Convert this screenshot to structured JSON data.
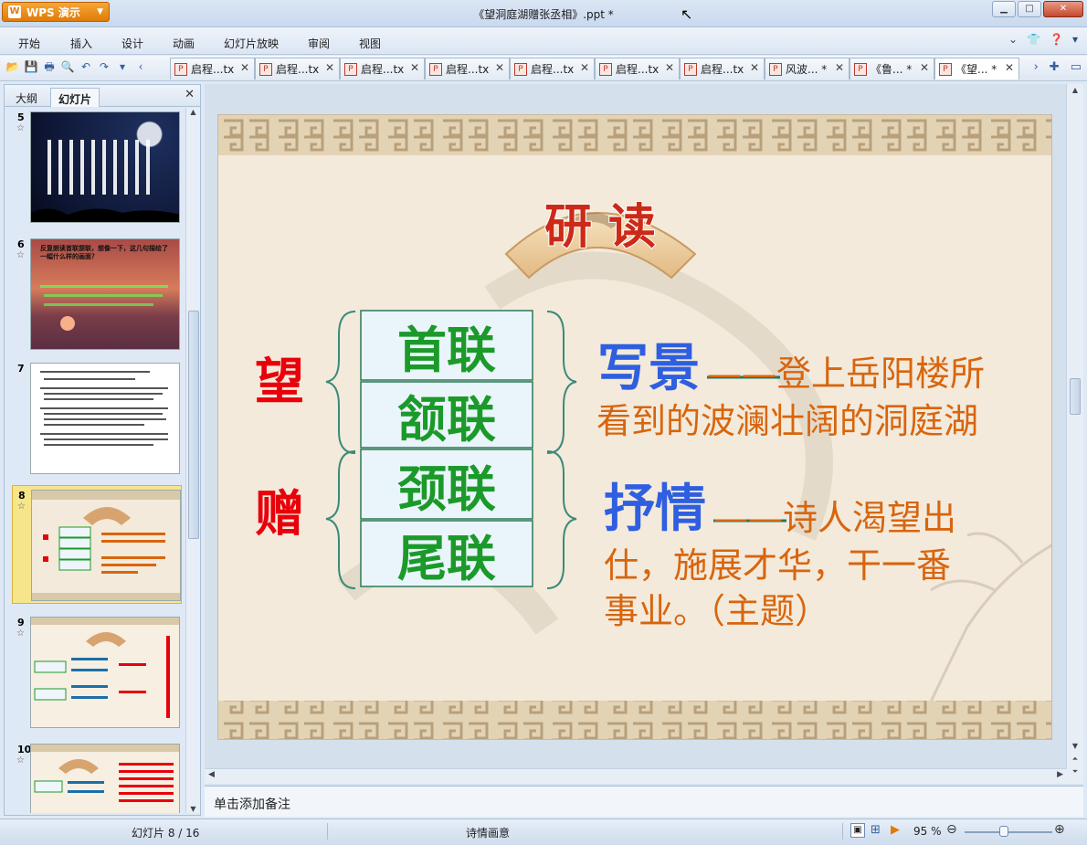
{
  "app": {
    "name": "WPS 演示",
    "doc_title": "《望洞庭湖赠张丞相》.ppt *"
  },
  "menu": [
    "开始",
    "插入",
    "设计",
    "动画",
    "幻灯片放映",
    "审阅",
    "视图"
  ],
  "tabs": [
    {
      "label": "启程...tx"
    },
    {
      "label": "启程...tx"
    },
    {
      "label": "启程...tx"
    },
    {
      "label": "启程...tx"
    },
    {
      "label": "启程...tx"
    },
    {
      "label": "启程...tx"
    },
    {
      "label": "启程...tx"
    },
    {
      "label": "风波... *"
    },
    {
      "label": "《鲁... *"
    },
    {
      "label": "《望... *"
    }
  ],
  "left_panel": {
    "tab_outline": "大纲",
    "tab_slides": "幻灯片"
  },
  "thumbnails": {
    "t5": {
      "num": "5"
    },
    "t6": {
      "num": "6",
      "title": "反复朗读首联颔联，想像一下，这几句描绘了一幅什么样的画面？"
    },
    "t7": {
      "num": "7"
    },
    "t8": {
      "num": "8"
    },
    "t9": {
      "num": "9"
    },
    "t10": {
      "num": "10"
    }
  },
  "slide": {
    "heading": "研  读",
    "char_wang": "望",
    "char_zeng": "赠",
    "boxes": [
      "首联",
      "颔联",
      "颈联",
      "尾联"
    ],
    "xiejing_title": "写景",
    "xiejing_line1": "——登上岳阳楼所",
    "xiejing_line2": "看到的波澜壮阔的洞庭湖",
    "shuqing_title": "抒情",
    "shuqing_line1": "——诗人渴望出",
    "shuqing_line2": "仕，施展才华，干一番",
    "shuqing_line3": "事业。（主题）"
  },
  "notes_placeholder": "单击添加备注",
  "status": {
    "slide_counter": "幻灯片 8 / 16",
    "theme": "诗情画意",
    "zoom": "95 %"
  },
  "colors": {
    "accent": "#e07b08",
    "green": "#1b9a2a",
    "blue": "#2f5fe0",
    "red": "#e8000b",
    "orange": "#d8650e"
  }
}
